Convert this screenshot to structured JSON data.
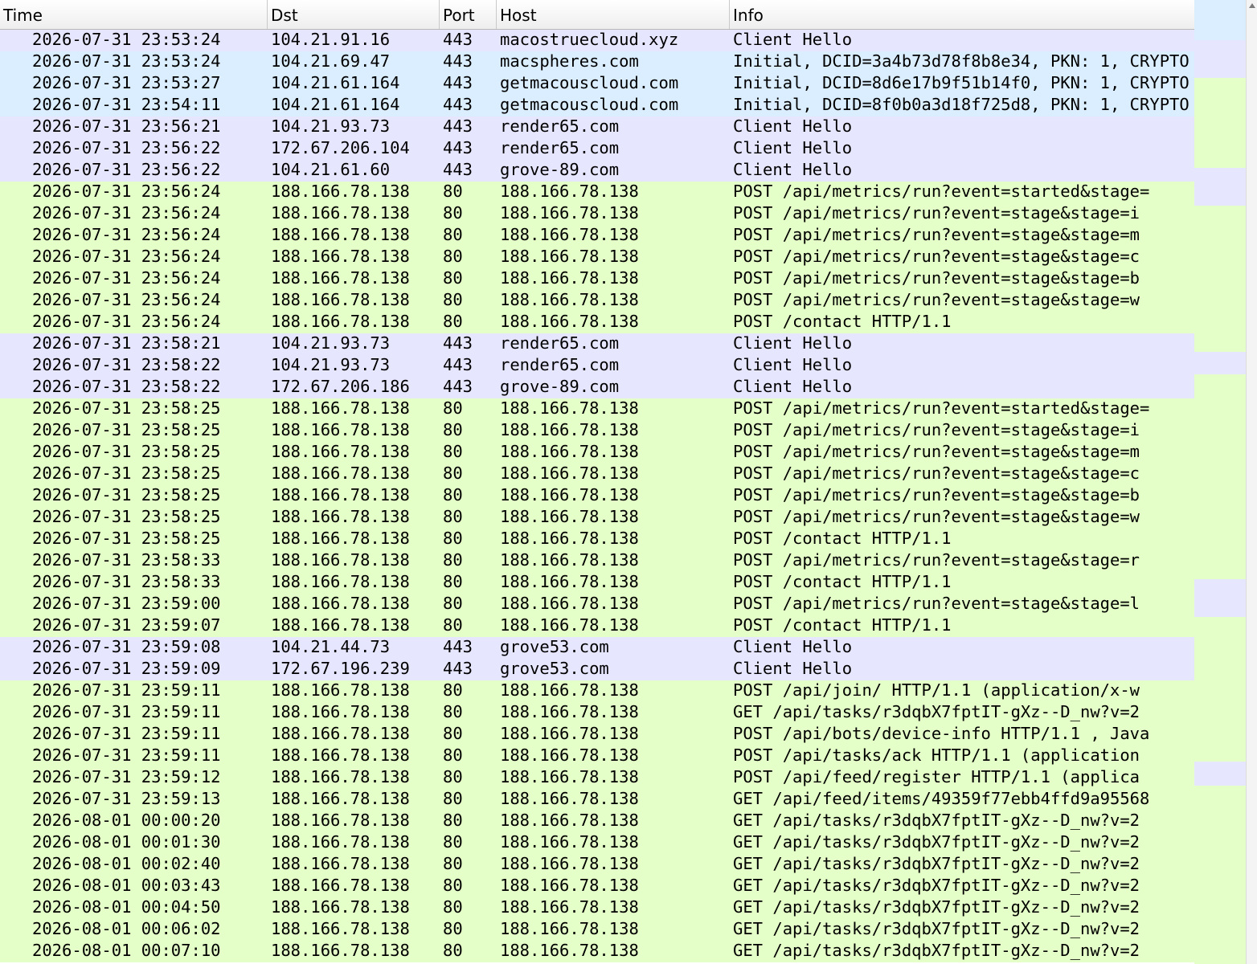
{
  "columns": {
    "time": "Time",
    "dst": "Dst",
    "port": "Port",
    "host": "Host",
    "info": "Info"
  },
  "colors": {
    "tls": "#e7e6ff",
    "quic": "#dbeeff",
    "http": "#e4ffc7"
  },
  "rows": [
    {
      "time": "2026-07-31 23:53:24",
      "dst": "104.21.91.16",
      "port": "443",
      "host": "macostruecloud.xyz",
      "info": "Client Hello",
      "kind": "tls"
    },
    {
      "time": "2026-07-31 23:53:24",
      "dst": "104.21.69.47",
      "port": "443",
      "host": "macspheres.com",
      "info": "Initial, DCID=3a4b73d78f8b8e34, PKN: 1, CRYPTO",
      "kind": "quic"
    },
    {
      "time": "2026-07-31 23:53:27",
      "dst": "104.21.61.164",
      "port": "443",
      "host": "getmacouscloud.com",
      "info": "Initial, DCID=8d6e17b9f51b14f0, PKN: 1, CRYPTO",
      "kind": "quic"
    },
    {
      "time": "2026-07-31 23:54:11",
      "dst": "104.21.61.164",
      "port": "443",
      "host": "getmacouscloud.com",
      "info": "Initial, DCID=8f0b0a3d18f725d8, PKN: 1, CRYPTO",
      "kind": "quic"
    },
    {
      "time": "2026-07-31 23:56:21",
      "dst": "104.21.93.73",
      "port": "443",
      "host": "render65.com",
      "info": "Client Hello",
      "kind": "tls"
    },
    {
      "time": "2026-07-31 23:56:22",
      "dst": "172.67.206.104",
      "port": "443",
      "host": "render65.com",
      "info": "Client Hello",
      "kind": "tls"
    },
    {
      "time": "2026-07-31 23:56:22",
      "dst": "104.21.61.60",
      "port": "443",
      "host": "grove-89.com",
      "info": "Client Hello",
      "kind": "tls"
    },
    {
      "time": "2026-07-31 23:56:24",
      "dst": "188.166.78.138",
      "port": "80",
      "host": "188.166.78.138",
      "info": "POST /api/metrics/run?event=started&stage=",
      "kind": "http"
    },
    {
      "time": "2026-07-31 23:56:24",
      "dst": "188.166.78.138",
      "port": "80",
      "host": "188.166.78.138",
      "info": "POST /api/metrics/run?event=stage&stage=i",
      "kind": "http"
    },
    {
      "time": "2026-07-31 23:56:24",
      "dst": "188.166.78.138",
      "port": "80",
      "host": "188.166.78.138",
      "info": "POST /api/metrics/run?event=stage&stage=m",
      "kind": "http"
    },
    {
      "time": "2026-07-31 23:56:24",
      "dst": "188.166.78.138",
      "port": "80",
      "host": "188.166.78.138",
      "info": "POST /api/metrics/run?event=stage&stage=c",
      "kind": "http"
    },
    {
      "time": "2026-07-31 23:56:24",
      "dst": "188.166.78.138",
      "port": "80",
      "host": "188.166.78.138",
      "info": "POST /api/metrics/run?event=stage&stage=b",
      "kind": "http"
    },
    {
      "time": "2026-07-31 23:56:24",
      "dst": "188.166.78.138",
      "port": "80",
      "host": "188.166.78.138",
      "info": "POST /api/metrics/run?event=stage&stage=w",
      "kind": "http"
    },
    {
      "time": "2026-07-31 23:56:24",
      "dst": "188.166.78.138",
      "port": "80",
      "host": "188.166.78.138",
      "info": "POST /contact HTTP/1.1",
      "kind": "http"
    },
    {
      "time": "2026-07-31 23:58:21",
      "dst": "104.21.93.73",
      "port": "443",
      "host": "render65.com",
      "info": "Client Hello",
      "kind": "tls"
    },
    {
      "time": "2026-07-31 23:58:22",
      "dst": "104.21.93.73",
      "port": "443",
      "host": "render65.com",
      "info": "Client Hello",
      "kind": "tls"
    },
    {
      "time": "2026-07-31 23:58:22",
      "dst": "172.67.206.186",
      "port": "443",
      "host": "grove-89.com",
      "info": "Client Hello",
      "kind": "tls"
    },
    {
      "time": "2026-07-31 23:58:25",
      "dst": "188.166.78.138",
      "port": "80",
      "host": "188.166.78.138",
      "info": "POST /api/metrics/run?event=started&stage=",
      "kind": "http"
    },
    {
      "time": "2026-07-31 23:58:25",
      "dst": "188.166.78.138",
      "port": "80",
      "host": "188.166.78.138",
      "info": "POST /api/metrics/run?event=stage&stage=i",
      "kind": "http"
    },
    {
      "time": "2026-07-31 23:58:25",
      "dst": "188.166.78.138",
      "port": "80",
      "host": "188.166.78.138",
      "info": "POST /api/metrics/run?event=stage&stage=m",
      "kind": "http"
    },
    {
      "time": "2026-07-31 23:58:25",
      "dst": "188.166.78.138",
      "port": "80",
      "host": "188.166.78.138",
      "info": "POST /api/metrics/run?event=stage&stage=c",
      "kind": "http"
    },
    {
      "time": "2026-07-31 23:58:25",
      "dst": "188.166.78.138",
      "port": "80",
      "host": "188.166.78.138",
      "info": "POST /api/metrics/run?event=stage&stage=b",
      "kind": "http"
    },
    {
      "time": "2026-07-31 23:58:25",
      "dst": "188.166.78.138",
      "port": "80",
      "host": "188.166.78.138",
      "info": "POST /api/metrics/run?event=stage&stage=w",
      "kind": "http"
    },
    {
      "time": "2026-07-31 23:58:25",
      "dst": "188.166.78.138",
      "port": "80",
      "host": "188.166.78.138",
      "info": "POST /contact HTTP/1.1",
      "kind": "http"
    },
    {
      "time": "2026-07-31 23:58:33",
      "dst": "188.166.78.138",
      "port": "80",
      "host": "188.166.78.138",
      "info": "POST /api/metrics/run?event=stage&stage=r",
      "kind": "http"
    },
    {
      "time": "2026-07-31 23:58:33",
      "dst": "188.166.78.138",
      "port": "80",
      "host": "188.166.78.138",
      "info": "POST /contact HTTP/1.1",
      "kind": "http"
    },
    {
      "time": "2026-07-31 23:59:00",
      "dst": "188.166.78.138",
      "port": "80",
      "host": "188.166.78.138",
      "info": "POST /api/metrics/run?event=stage&stage=l",
      "kind": "http"
    },
    {
      "time": "2026-07-31 23:59:07",
      "dst": "188.166.78.138",
      "port": "80",
      "host": "188.166.78.138",
      "info": "POST /contact HTTP/1.1",
      "kind": "http"
    },
    {
      "time": "2026-07-31 23:59:08",
      "dst": "104.21.44.73",
      "port": "443",
      "host": "grove53.com",
      "info": "Client Hello",
      "kind": "tls"
    },
    {
      "time": "2026-07-31 23:59:09",
      "dst": "172.67.196.239",
      "port": "443",
      "host": "grove53.com",
      "info": "Client Hello",
      "kind": "tls"
    },
    {
      "time": "2026-07-31 23:59:11",
      "dst": "188.166.78.138",
      "port": "80",
      "host": "188.166.78.138",
      "info": "POST /api/join/ HTTP/1.1  (application/x-w",
      "kind": "http"
    },
    {
      "time": "2026-07-31 23:59:11",
      "dst": "188.166.78.138",
      "port": "80",
      "host": "188.166.78.138",
      "info": "GET /api/tasks/r3dqbX7fptIT-gXz--D_nw?v=2",
      "kind": "http"
    },
    {
      "time": "2026-07-31 23:59:11",
      "dst": "188.166.78.138",
      "port": "80",
      "host": "188.166.78.138",
      "info": "POST /api/bots/device-info HTTP/1.1 , Java",
      "kind": "http"
    },
    {
      "time": "2026-07-31 23:59:11",
      "dst": "188.166.78.138",
      "port": "80",
      "host": "188.166.78.138",
      "info": "POST /api/tasks/ack HTTP/1.1  (application",
      "kind": "http"
    },
    {
      "time": "2026-07-31 23:59:12",
      "dst": "188.166.78.138",
      "port": "80",
      "host": "188.166.78.138",
      "info": "POST /api/feed/register HTTP/1.1  (applica",
      "kind": "http"
    },
    {
      "time": "2026-07-31 23:59:13",
      "dst": "188.166.78.138",
      "port": "80",
      "host": "188.166.78.138",
      "info": "GET /api/feed/items/49359f77ebb4ffd9a95568",
      "kind": "http"
    },
    {
      "time": "2026-08-01 00:00:20",
      "dst": "188.166.78.138",
      "port": "80",
      "host": "188.166.78.138",
      "info": "GET /api/tasks/r3dqbX7fptIT-gXz--D_nw?v=2",
      "kind": "http"
    },
    {
      "time": "2026-08-01 00:01:30",
      "dst": "188.166.78.138",
      "port": "80",
      "host": "188.166.78.138",
      "info": "GET /api/tasks/r3dqbX7fptIT-gXz--D_nw?v=2",
      "kind": "http"
    },
    {
      "time": "2026-08-01 00:02:40",
      "dst": "188.166.78.138",
      "port": "80",
      "host": "188.166.78.138",
      "info": "GET /api/tasks/r3dqbX7fptIT-gXz--D_nw?v=2",
      "kind": "http"
    },
    {
      "time": "2026-08-01 00:03:43",
      "dst": "188.166.78.138",
      "port": "80",
      "host": "188.166.78.138",
      "info": "GET /api/tasks/r3dqbX7fptIT-gXz--D_nw?v=2",
      "kind": "http"
    },
    {
      "time": "2026-08-01 00:04:50",
      "dst": "188.166.78.138",
      "port": "80",
      "host": "188.166.78.138",
      "info": "GET /api/tasks/r3dqbX7fptIT-gXz--D_nw?v=2",
      "kind": "http"
    },
    {
      "time": "2026-08-01 00:06:02",
      "dst": "188.166.78.138",
      "port": "80",
      "host": "188.166.78.138",
      "info": "GET /api/tasks/r3dqbX7fptIT-gXz--D_nw?v=2",
      "kind": "http"
    },
    {
      "time": "2026-08-01 00:07:10",
      "dst": "188.166.78.138",
      "port": "80",
      "host": "188.166.78.138",
      "info": "GET /api/tasks/r3dqbX7fptIT-gXz--D_nw?v=2",
      "kind": "http"
    }
  ],
  "minimap": [
    {
      "kind": "quic",
      "from": 0.0,
      "to": 0.042
    },
    {
      "kind": "tls",
      "from": 0.042,
      "to": 0.081
    },
    {
      "kind": "tls",
      "from": 0.174,
      "to": 0.213
    },
    {
      "kind": "tls",
      "from": 0.365,
      "to": 0.388
    },
    {
      "kind": "tls",
      "from": 0.601,
      "to": 0.64
    },
    {
      "kind": "tls",
      "from": 0.79,
      "to": 0.815
    }
  ]
}
